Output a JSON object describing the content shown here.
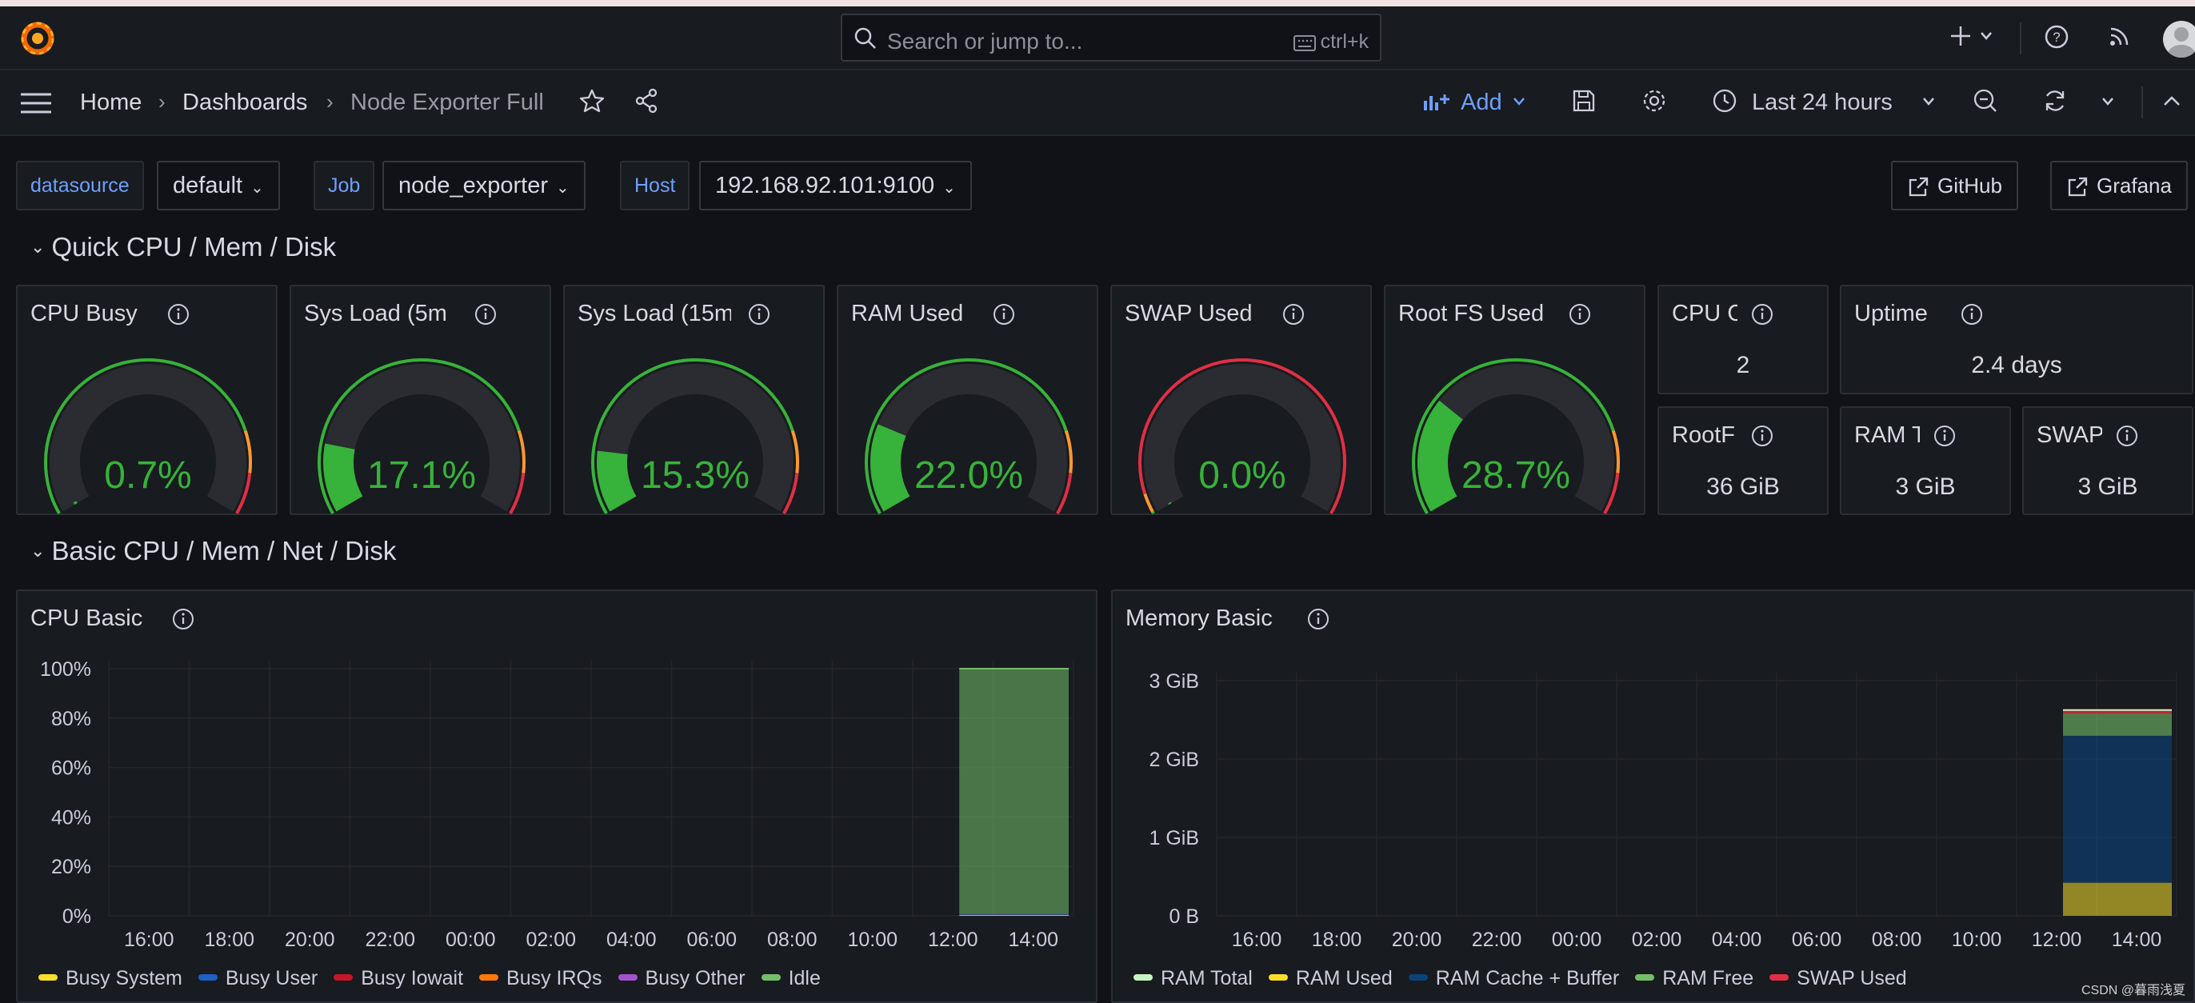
{
  "search": {
    "placeholder": "Search or jump to...",
    "shortcut": "ctrl+k"
  },
  "breadcrumbs": [
    "Home",
    "Dashboards",
    "Node Exporter Full"
  ],
  "toolbar": {
    "add_label": "Add",
    "time_range": "Last 24 hours"
  },
  "variables": [
    {
      "label": "datasource",
      "value": "default"
    },
    {
      "label": "Job",
      "value": "node_exporter"
    },
    {
      "label": "Host",
      "value": "192.168.92.101:9100"
    }
  ],
  "links": [
    "GitHub",
    "Grafana"
  ],
  "rows": {
    "quick": "Quick CPU / Mem / Disk",
    "basic": "Basic CPU / Mem / Net / Disk"
  },
  "gauges": [
    {
      "title": "CPU Busy",
      "value": "0.7%",
      "percent": 0.7
    },
    {
      "title": "Sys Load (5m",
      "value": "17.1%",
      "percent": 17.1
    },
    {
      "title": "Sys Load (15m",
      "value": "15.3%",
      "percent": 15.3
    },
    {
      "title": "RAM Used",
      "value": "22.0%",
      "percent": 22.0
    },
    {
      "title": "SWAP Used",
      "value": "0.0%",
      "percent": 0.0
    },
    {
      "title": "Root FS Used",
      "value": "28.7%",
      "percent": 28.7
    }
  ],
  "stats": [
    {
      "title": "CPU C",
      "value": "2"
    },
    {
      "title": "Uptime",
      "value": "2.4 days"
    },
    {
      "title": "RootF",
      "value": "36 GiB"
    },
    {
      "title": "RAM T",
      "value": "3 GiB"
    },
    {
      "title": "SWAP",
      "value": "3 GiB"
    }
  ],
  "colors": {
    "gauge_green": "#37b23a",
    "gauge_track": "#2a2c31",
    "threshold_red": "#e02f44",
    "threshold_orange": "#ff9830",
    "accent_blue": "#6e9fff"
  },
  "chart_data": [
    {
      "type": "area",
      "title": "CPU Basic",
      "x": [
        "16:00",
        "18:00",
        "20:00",
        "22:00",
        "00:00",
        "02:00",
        "04:00",
        "06:00",
        "08:00",
        "10:00",
        "12:00",
        "14:00"
      ],
      "y_ticks": [
        "100%",
        "80%",
        "60%",
        "40%",
        "20%",
        "0%"
      ],
      "ylim": [
        0,
        100
      ],
      "series": [
        {
          "name": "Busy System",
          "color": "#fade2a",
          "values": [
            null,
            null,
            null,
            null,
            null,
            null,
            null,
            null,
            null,
            null,
            0.3,
            0.3
          ]
        },
        {
          "name": "Busy User",
          "color": "#1f60c4",
          "values": [
            null,
            null,
            null,
            null,
            null,
            null,
            null,
            null,
            null,
            null,
            0.3,
            0.3
          ]
        },
        {
          "name": "Busy Iowait",
          "color": "#c4162a",
          "values": [
            null,
            null,
            null,
            null,
            null,
            null,
            null,
            null,
            null,
            null,
            0.1,
            0.1
          ]
        },
        {
          "name": "Busy IRQs",
          "color": "#ff780a",
          "values": [
            null,
            null,
            null,
            null,
            null,
            null,
            null,
            null,
            null,
            null,
            0,
            0
          ]
        },
        {
          "name": "Busy Other",
          "color": "#a352cc",
          "values": [
            null,
            null,
            null,
            null,
            null,
            null,
            null,
            null,
            null,
            null,
            0,
            0
          ]
        },
        {
          "name": "Idle",
          "color": "#73bf69",
          "values": [
            null,
            null,
            null,
            null,
            null,
            null,
            null,
            null,
            null,
            null,
            99.3,
            99.3
          ]
        }
      ]
    },
    {
      "type": "area",
      "title": "Memory Basic",
      "x": [
        "16:00",
        "18:00",
        "20:00",
        "22:00",
        "00:00",
        "02:00",
        "04:00",
        "06:00",
        "08:00",
        "10:00",
        "12:00",
        "14:00"
      ],
      "y_ticks": [
        "3 GiB",
        "2 GiB",
        "1 GiB",
        "0 B"
      ],
      "ylim": [
        0,
        3.2
      ],
      "series": [
        {
          "name": "RAM Total",
          "color": "#c8f2c2",
          "values": [
            null,
            null,
            null,
            null,
            null,
            null,
            null,
            null,
            null,
            null,
            2.8,
            2.8
          ]
        },
        {
          "name": "RAM Used",
          "color": "#fade2a",
          "values": [
            null,
            null,
            null,
            null,
            null,
            null,
            null,
            null,
            null,
            null,
            0.45,
            0.45
          ]
        },
        {
          "name": "RAM Cache + Buffer",
          "color": "#0a437c",
          "values": [
            null,
            null,
            null,
            null,
            null,
            null,
            null,
            null,
            null,
            null,
            1.9,
            2.0
          ]
        },
        {
          "name": "RAM Free",
          "color": "#73bf69",
          "values": [
            null,
            null,
            null,
            null,
            null,
            null,
            null,
            null,
            null,
            null,
            0.4,
            0.3
          ]
        },
        {
          "name": "SWAP Used",
          "color": "#e02f44",
          "values": [
            null,
            null,
            null,
            null,
            null,
            null,
            null,
            null,
            null,
            null,
            0.03,
            0.03
          ]
        }
      ]
    }
  ],
  "watermark": "CSDN @暮雨浅夏"
}
